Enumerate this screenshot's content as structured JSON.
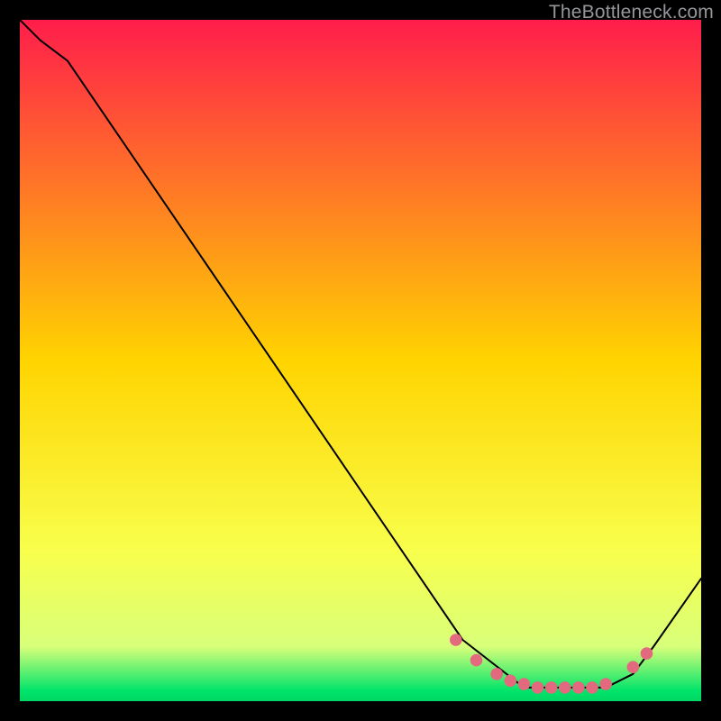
{
  "watermark": "TheBottleneck.com",
  "chart_data": {
    "type": "line",
    "title": "",
    "xlabel": "",
    "ylabel": "",
    "xlim": [
      0,
      100
    ],
    "ylim": [
      0,
      100
    ],
    "grid": false,
    "legend": false,
    "background_gradient": {
      "stops": [
        {
          "pos": 0.0,
          "color": "#ff1d4b"
        },
        {
          "pos": 0.5,
          "color": "#ffd400"
        },
        {
          "pos": 0.78,
          "color": "#f8ff4c"
        },
        {
          "pos": 0.92,
          "color": "#d8ff7a"
        },
        {
          "pos": 0.985,
          "color": "#00e46a"
        },
        {
          "pos": 1.0,
          "color": "#00d763"
        }
      ]
    },
    "series": [
      {
        "name": "bottleneck-curve",
        "color": "#000000",
        "x": [
          0,
          3,
          7,
          65,
          74,
          86,
          90,
          93,
          100
        ],
        "y": [
          100,
          97,
          94,
          9,
          2,
          2,
          4,
          8,
          18
        ]
      }
    ],
    "markers": {
      "name": "optimal-range",
      "color": "#e3697e",
      "radius_pct": 0.9,
      "points": [
        {
          "x": 64,
          "y": 9
        },
        {
          "x": 67,
          "y": 6
        },
        {
          "x": 70,
          "y": 4
        },
        {
          "x": 72,
          "y": 3
        },
        {
          "x": 74,
          "y": 2.5
        },
        {
          "x": 76,
          "y": 2
        },
        {
          "x": 78,
          "y": 2
        },
        {
          "x": 80,
          "y": 2
        },
        {
          "x": 82,
          "y": 2
        },
        {
          "x": 84,
          "y": 2
        },
        {
          "x": 86,
          "y": 2.5
        },
        {
          "x": 90,
          "y": 5
        },
        {
          "x": 92,
          "y": 7
        }
      ]
    }
  }
}
